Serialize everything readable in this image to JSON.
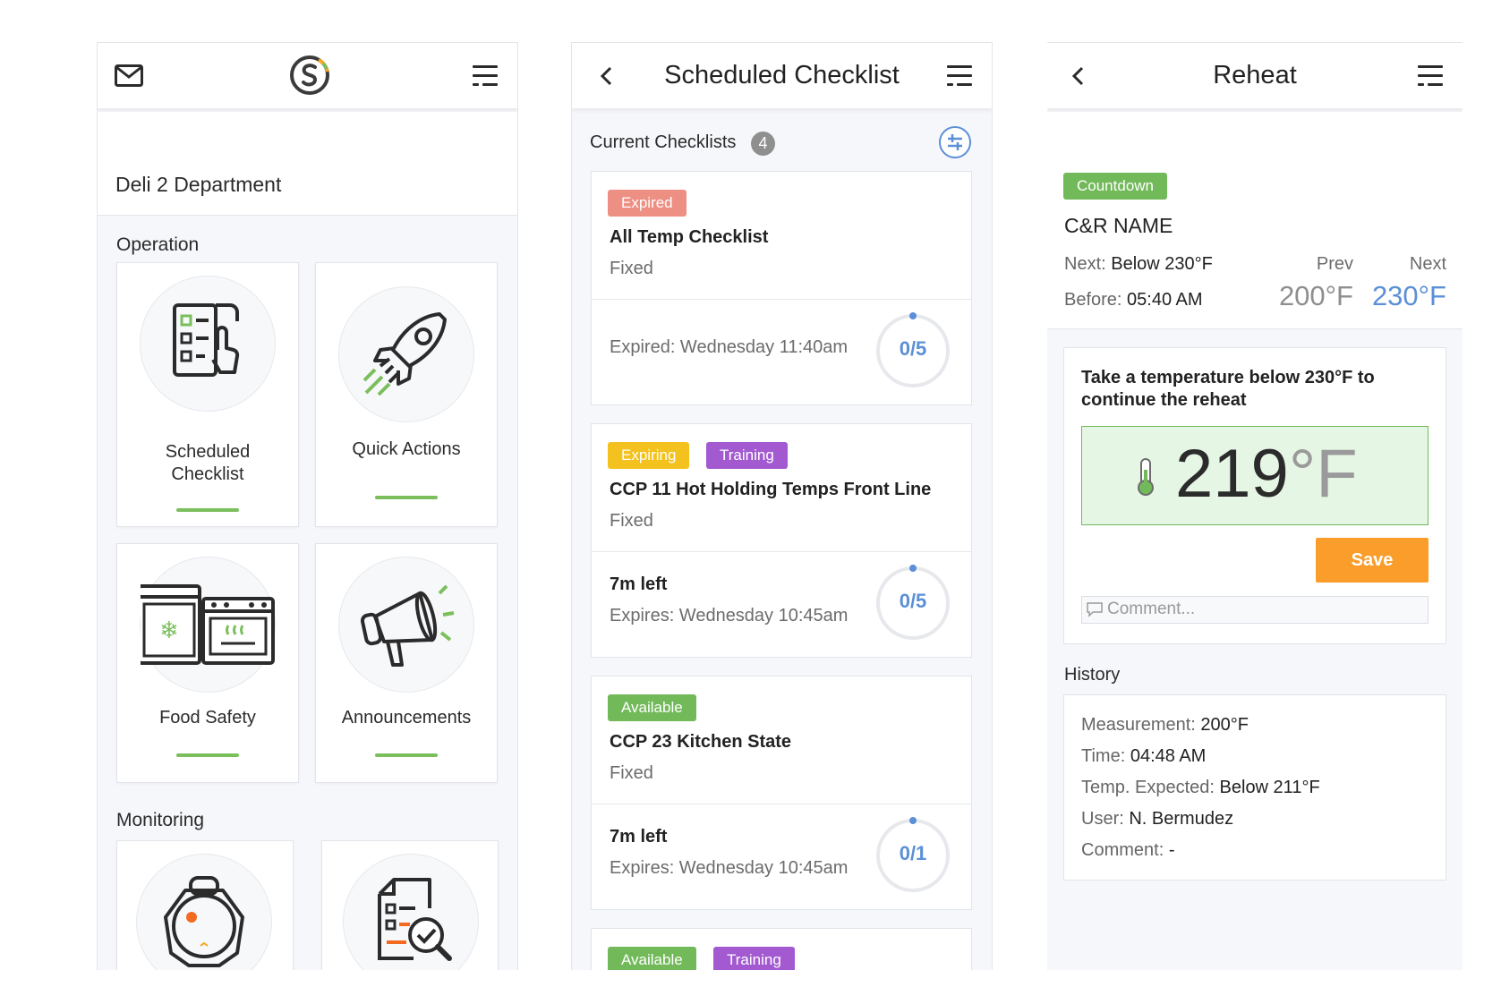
{
  "colors": {
    "brand_green": "#7bbf5c",
    "expired_badge": "#ee8f84",
    "expiring_badge": "#f4c21e",
    "training_badge": "#a35ad1",
    "available_badge": "#72b95a",
    "countdown_badge": "#72b95a",
    "progress_blue": "#5b8fd6",
    "save_orange": "#fb9d2b",
    "reading_bg": "#e6f6e4"
  },
  "home": {
    "department": "Deli 2 Department",
    "sections": {
      "operation": "Operation",
      "monitoring": "Monitoring"
    },
    "tiles": [
      {
        "label": "Scheduled\nChecklist",
        "icon": "checklist-icon"
      },
      {
        "label": "Quick Actions",
        "icon": "rocket-icon"
      },
      {
        "label": "Food Safety",
        "icon": "fridge-oven-icon"
      },
      {
        "label": "Announcements",
        "icon": "megaphone-icon"
      }
    ],
    "monitoring_tiles": [
      {
        "icon": "sensor-icon"
      },
      {
        "icon": "report-search-icon"
      }
    ]
  },
  "checklist": {
    "title": "Scheduled Checklist",
    "current_label": "Current Checklists",
    "count": "4",
    "cards": [
      {
        "badges": [
          "Expired"
        ],
        "name": "All Temp Checklist",
        "type": "Fixed",
        "time_left": "",
        "expires": "Expired: Wednesday 11:40am",
        "progress": {
          "done": 0,
          "total": 5,
          "text": "0/5"
        }
      },
      {
        "badges": [
          "Expiring",
          "Training"
        ],
        "name": "CCP 11 Hot Holding Temps Front Line",
        "type": "Fixed",
        "time_left": "7m left",
        "expires": "Expires: Wednesday 10:45am",
        "progress": {
          "done": 0,
          "total": 5,
          "text": "0/5"
        }
      },
      {
        "badges": [
          "Available"
        ],
        "name": "CCP 23 Kitchen State",
        "type": "Fixed",
        "time_left": "7m left",
        "expires": "Expires: Wednesday 10:45am",
        "progress": {
          "done": 0,
          "total": 1,
          "text": "0/1"
        }
      },
      {
        "badges": [
          "Available",
          "Training"
        ]
      }
    ]
  },
  "reheat": {
    "title": "Reheat",
    "badge": "Countdown",
    "name": "C&R NAME",
    "next_label": "Next:",
    "next_value": "Below 230°F",
    "before_label": "Before:",
    "before_value": "05:40 AM",
    "prev_header": "Prev",
    "next_header": "Next",
    "prev_temp": "200°F",
    "next_temp": "230°F",
    "instruction": "Take a temperature below 230°F to continue the reheat",
    "reading_value": "219",
    "reading_unit": "°F",
    "save_label": "Save",
    "comment_placeholder": "Comment...",
    "history_label": "History",
    "history": {
      "measurement_label": "Measurement:",
      "measurement_value": "200°F",
      "time_label": "Time:",
      "time_value": "04:48 AM",
      "expected_label": "Temp. Expected:",
      "expected_value": "Below 211°F",
      "user_label": "User:",
      "user_value": "N. Bermudez",
      "comment_label": "Comment:",
      "comment_value": "-"
    }
  }
}
